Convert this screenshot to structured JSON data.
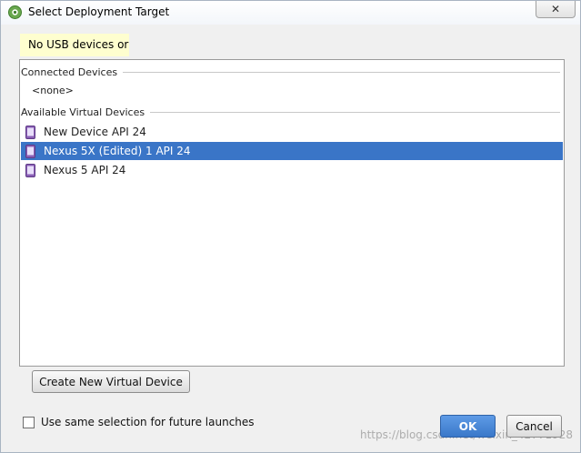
{
  "window": {
    "title": "Select Deployment Target",
    "close_label": "✕"
  },
  "warning": {
    "text": "No USB devices or"
  },
  "device_list": {
    "connected_header": "Connected Devices",
    "connected_empty": "<none>",
    "virtual_header": "Available Virtual Devices",
    "virtual_devices": [
      {
        "name": "New Device API 24",
        "selected": false
      },
      {
        "name": "Nexus 5X (Edited) 1 API 24",
        "selected": true
      },
      {
        "name": "Nexus 5 API 24",
        "selected": false
      }
    ]
  },
  "buttons": {
    "create_label": "Create New Virtual Device",
    "ok_label": "OK",
    "cancel_label": "Cancel"
  },
  "checkbox": {
    "label": "Use same selection for future launches",
    "checked": false
  },
  "watermark": {
    "text": "https://blog.csdn.net/weixin_42771928"
  },
  "colors": {
    "selection": "#3a75c7",
    "warning_bg": "#fefecf",
    "phone_icon": "#8a5fb5"
  },
  "icons": {
    "app": "android-studio-icon",
    "device": "phone-icon"
  }
}
